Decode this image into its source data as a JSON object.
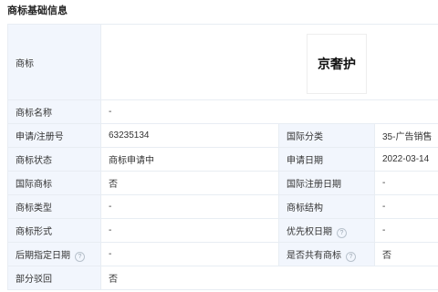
{
  "section_title": "商标基础信息",
  "logo": {
    "label": "商标",
    "image_text": "京奢护"
  },
  "rows": {
    "name": {
      "label": "商标名称",
      "value": "-"
    },
    "reg_no": {
      "label": "申请/注册号",
      "value": "63235134"
    },
    "class": {
      "label": "国际分类",
      "value": "35-广告销售"
    },
    "status": {
      "label": "商标状态",
      "value": "商标申请中"
    },
    "apply_date": {
      "label": "申请日期",
      "value": "2022-03-14"
    },
    "intl": {
      "label": "国际商标",
      "value": "否"
    },
    "intl_reg_date": {
      "label": "国际注册日期",
      "value": "-"
    },
    "type": {
      "label": "商标类型",
      "value": "-"
    },
    "structure": {
      "label": "商标结构",
      "value": "-"
    },
    "form": {
      "label": "商标形式",
      "value": "-"
    },
    "priority_date": {
      "label": "优先权日期",
      "value": "-"
    },
    "later_date": {
      "label": "后期指定日期",
      "value": "-"
    },
    "shared": {
      "label": "是否共有商标",
      "value": "否"
    },
    "partial_reject": {
      "label": "部分驳回",
      "value": "否"
    }
  },
  "colors": {
    "label_bg": "#f2f6fd",
    "border": "#e8edf3",
    "help_icon": "#b8c2cc"
  },
  "icons": {
    "help": "question-circle-icon"
  }
}
